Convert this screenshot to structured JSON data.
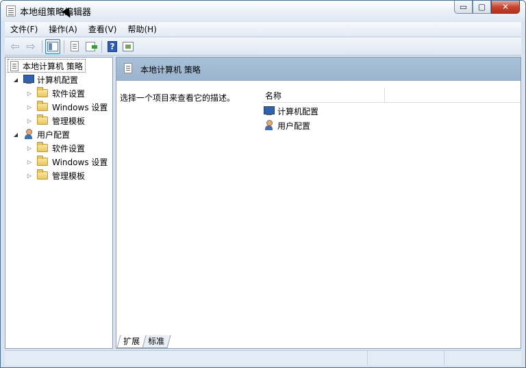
{
  "window": {
    "title": "本地组策略编辑器",
    "controls": {
      "minimize": "▭",
      "maximize": "▢",
      "close": "✕"
    }
  },
  "menubar": {
    "items": [
      "文件(F)",
      "操作(A)",
      "查看(V)",
      "帮助(H)"
    ]
  },
  "toolbar": {
    "back_icon": "arrow-left-icon",
    "forward_icon": "arrow-right-icon",
    "help_glyph": "?"
  },
  "tree": {
    "root": "本地计算机 策略",
    "computer": {
      "label": "计算机配置",
      "children": [
        "软件设置",
        "Windows 设置",
        "管理模板"
      ]
    },
    "user": {
      "label": "用户配置",
      "children": [
        "软件设置",
        "Windows 设置",
        "管理模板"
      ]
    }
  },
  "main": {
    "header_title": "本地计算机 策略",
    "description": "选择一个项目来查看它的描述。",
    "column_name": "名称",
    "items": [
      "计算机配置",
      "用户配置"
    ],
    "tabs": [
      "扩展",
      "标准"
    ]
  }
}
